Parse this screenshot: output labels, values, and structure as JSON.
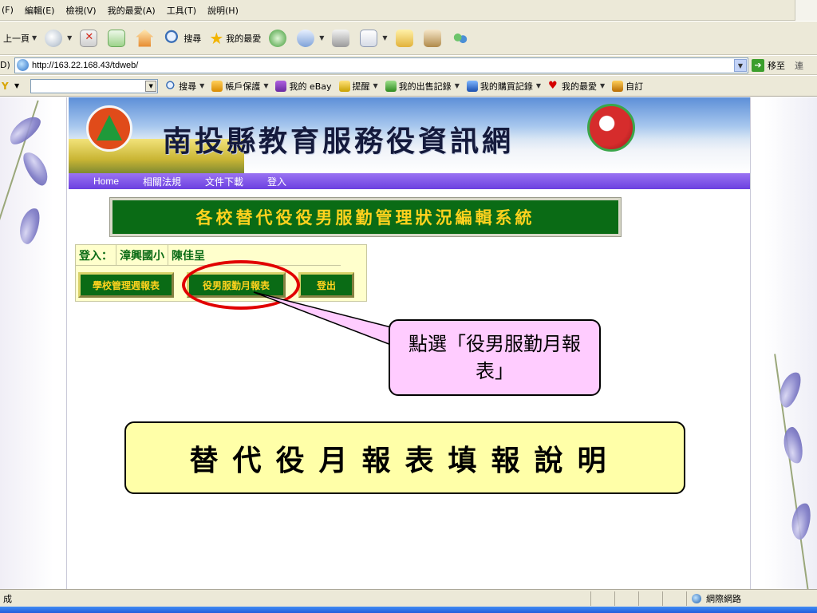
{
  "menu": {
    "items": [
      "(F)",
      "編輯(E)",
      "檢視(V)",
      "我的最愛(A)",
      "工具(T)",
      "說明(H)"
    ]
  },
  "toolbar": {
    "back_label": "上一頁",
    "search_label": "搜尋",
    "favorites_label": "我的最愛"
  },
  "address": {
    "label": "D)",
    "url": "http://163.22.168.43/tdweb/",
    "go_label": "移至",
    "links_label": "連"
  },
  "googlebar": {
    "search_label": "搜尋",
    "account_label": "帳戶保護",
    "ebay_label": "我的 eBay",
    "reminder_label": "提醒",
    "selling_label": "我的出售記錄",
    "buying_label": "我的購買記錄",
    "fav_label": "我的最愛",
    "custom_label": "自訂"
  },
  "site": {
    "banner_title": "南投縣教育服務役資訊網",
    "nav": [
      "Home",
      "相關法規",
      "文件下載",
      "登入"
    ],
    "system_title": "各校替代役役男服勤管理狀況編輯系統",
    "login": {
      "label": "登入：",
      "school": "漳興國小",
      "user": "陳佳呈"
    },
    "buttons": {
      "weekly": "學校管理週報表",
      "monthly": "役男服勤月報表",
      "logout": "登出"
    }
  },
  "annotation": {
    "callout": "點選「役男服勤月報表」",
    "caption": "替代役月報表填報說明"
  },
  "status": {
    "text": "成",
    "zone": "網際網路"
  },
  "colors": {
    "header_green": "#0a6b15",
    "title_yellow": "#ffd21e",
    "nav_purple": "#6b3fe0",
    "highlight_red": "#e10000",
    "callout_pink": "#ffccff",
    "caption_yellow": "#ffffa8"
  }
}
